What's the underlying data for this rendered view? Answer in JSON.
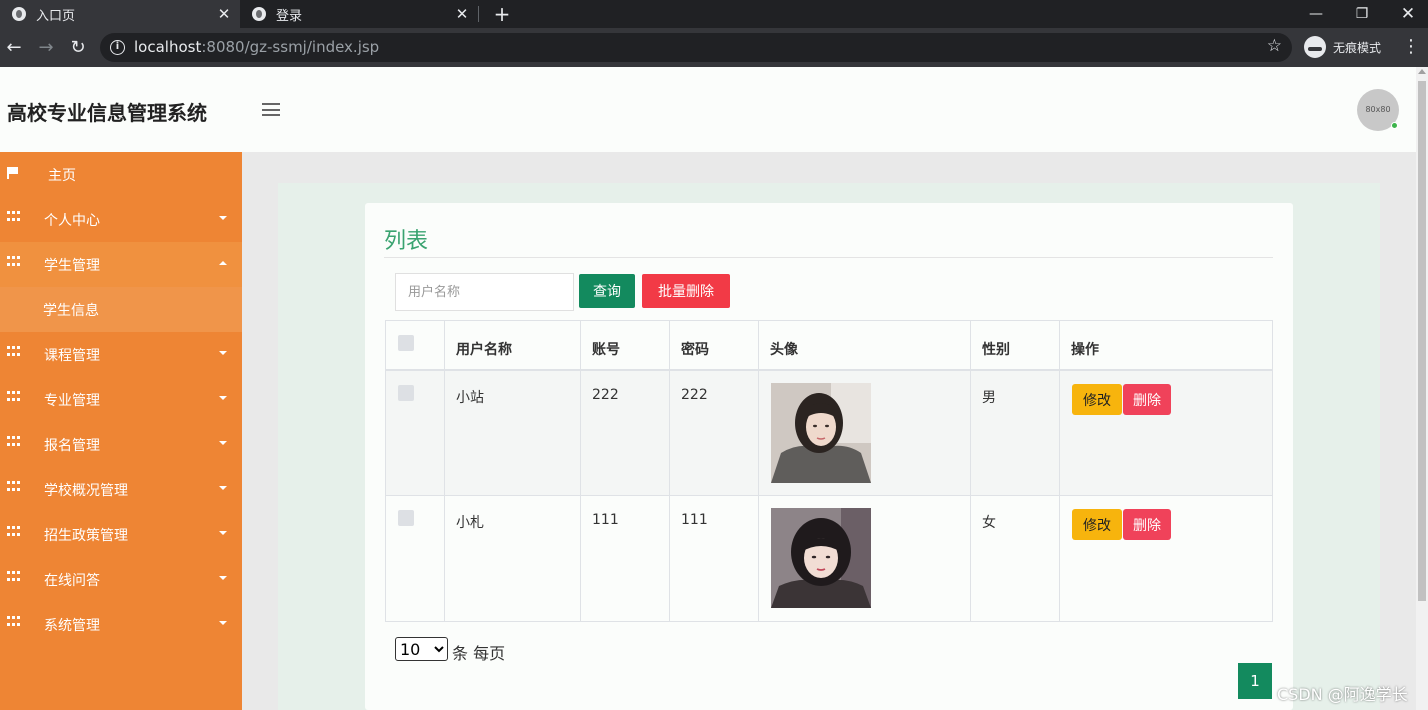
{
  "browser": {
    "tabs": [
      {
        "title": "入口页",
        "icon": "globe-icon"
      },
      {
        "title": "登录",
        "icon": "globe-icon"
      }
    ],
    "url_host": "localhost",
    "url_rest": ":8080/gz-ssmj/index.jsp",
    "incognito_label": "无痕模式"
  },
  "header": {
    "title": "高校专业信息管理系统",
    "avatar_text": "80x80"
  },
  "sidebar": {
    "items": [
      {
        "label": "主页",
        "icon": "flag-icon"
      },
      {
        "label": "个人中心",
        "icon": "grid-icon"
      },
      {
        "label": "学生管理",
        "icon": "grid-icon",
        "expanded": true
      },
      {
        "label": "学生信息"
      },
      {
        "label": "课程管理",
        "icon": "grid-icon"
      },
      {
        "label": "专业管理",
        "icon": "grid-icon"
      },
      {
        "label": "报名管理",
        "icon": "grid-icon"
      },
      {
        "label": "学校概况管理",
        "icon": "grid-icon"
      },
      {
        "label": "招生政策管理",
        "icon": "grid-icon"
      },
      {
        "label": "在线问答",
        "icon": "grid-icon"
      },
      {
        "label": "系统管理",
        "icon": "grid-icon"
      }
    ]
  },
  "main": {
    "title": "列表",
    "search_placeholder": "用户名称",
    "query_label": "查询",
    "batch_delete_label": "批量删除",
    "columns": [
      "用户名称",
      "账号",
      "密码",
      "头像",
      "性别",
      "操作"
    ],
    "rows": [
      {
        "name": "小站",
        "account": "222",
        "password": "222",
        "gender": "男"
      },
      {
        "name": "小札",
        "account": "111",
        "password": "111",
        "gender": "女"
      }
    ],
    "edit_label": "修改",
    "delete_label": "删除",
    "page_size": "10",
    "page_size_options": [
      "10"
    ],
    "per_page_text": "条 每页",
    "current_page": "1"
  },
  "watermark": "CSDN @阿逸学长",
  "colors": {
    "sidebar": "#ee8534",
    "accent_green": "#138a5e",
    "danger": "#f23a46",
    "warning": "#f7b40d"
  }
}
